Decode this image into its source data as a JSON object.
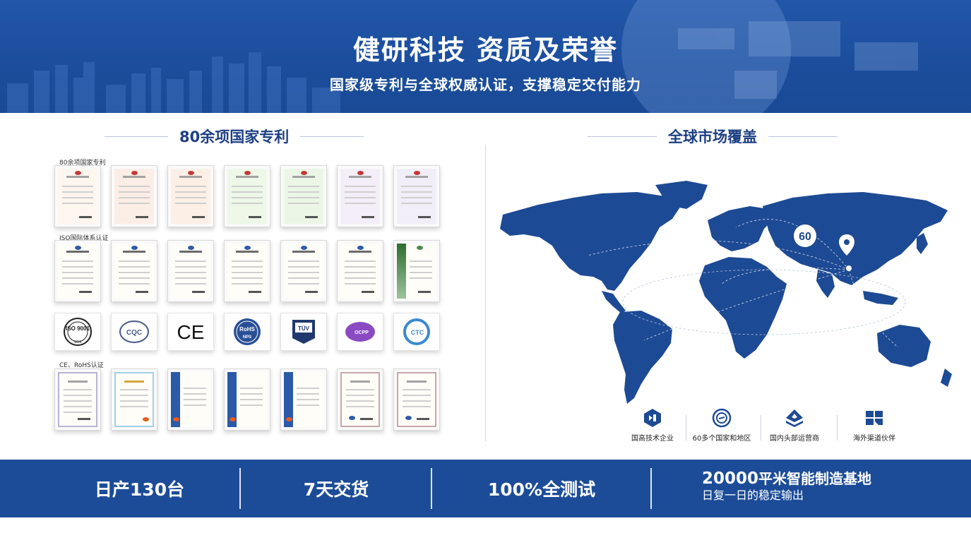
{
  "header": {
    "title": "健研科技 资质及荣誉",
    "subtitle": "国家级专利与全球权威认证，支撑稳定交付能力"
  },
  "patents_section": {
    "title": "80余项国家专利",
    "groups": {
      "patents_label": "80余项国家专利",
      "iso_label": "ISO国际体系认证",
      "ce_label": "CE、RoHS认证"
    },
    "logos": [
      {
        "name": "iso-9001-logo",
        "text": "ISO 9001"
      },
      {
        "name": "cqc-logo",
        "text": "CQC"
      },
      {
        "name": "ce-logo",
        "text": "CE"
      },
      {
        "name": "rohs-logo",
        "text": "RoHS"
      },
      {
        "name": "tuv-logo",
        "text": "TÜV"
      },
      {
        "name": "ocpp-logo",
        "text": "OCPP"
      },
      {
        "name": "ctc-logo",
        "text": "CTC"
      }
    ]
  },
  "market_section": {
    "title": "全球市场覆盖",
    "map_badge": "60",
    "features": [
      {
        "label": "国高技术企业",
        "icon": "hightech-badge-icon"
      },
      {
        "label": "60多个国家和地区",
        "icon": "globe-seal-icon"
      },
      {
        "label": "国内头部运营商",
        "icon": "layers-icon"
      },
      {
        "label": "海外渠道伙伴",
        "icon": "partner-blocks-icon"
      }
    ]
  },
  "stats": {
    "daily_output": "日产130台",
    "delivery": "7天交货",
    "testing": "100%全测试",
    "factory_number": "20000",
    "factory_title": "平米智能制造基地",
    "factory_sub": "日复一日的稳定输出"
  },
  "colors": {
    "primary_blue": "#1c4c98",
    "heading_blue": "#1d3f84",
    "map_blue": "#1d4a94"
  }
}
